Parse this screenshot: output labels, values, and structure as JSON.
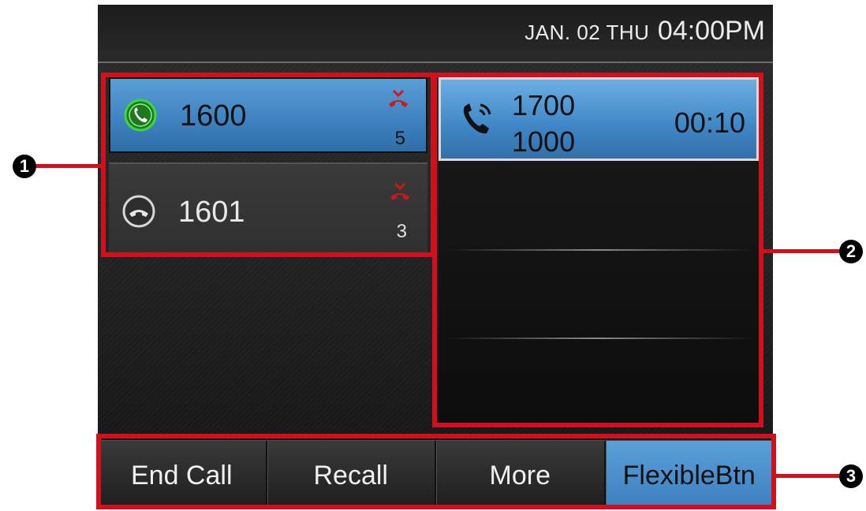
{
  "statusbar": {
    "date": "JAN. 02 THU",
    "time": "04:00PM"
  },
  "lines": [
    {
      "number": "1600",
      "missed": "5",
      "state": "active"
    },
    {
      "number": "1601",
      "missed": "3",
      "state": "idle"
    }
  ],
  "call": {
    "number": "1700",
    "sub_number": "1000",
    "timer": "00:10"
  },
  "softkeys": [
    {
      "label": "End Call"
    },
    {
      "label": "Recall"
    },
    {
      "label": "More"
    },
    {
      "label": "FlexibleBtn"
    }
  ],
  "callouts": [
    "1",
    "2",
    "3"
  ],
  "colors": {
    "highlight": "#3f83c2",
    "callout": "#d2101c",
    "missed": "#d01818",
    "active_line": "#2fb62f"
  }
}
